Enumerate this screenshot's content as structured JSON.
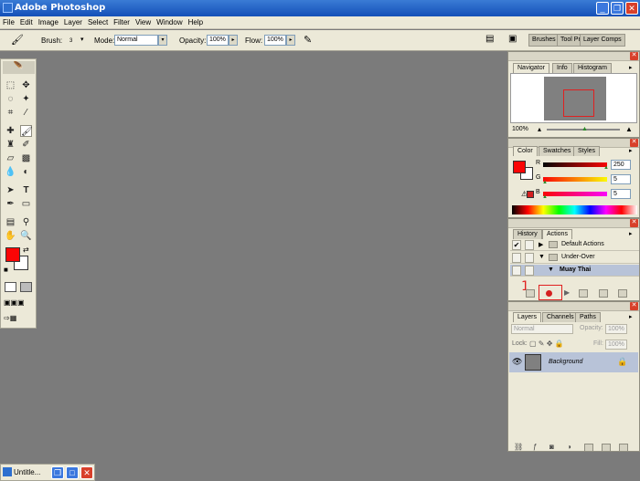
{
  "window": {
    "title": "Adobe Photoshop",
    "minimize": "_",
    "restore": "❐",
    "close": "✕"
  },
  "menu": [
    "File",
    "Edit",
    "Image",
    "Layer",
    "Select",
    "Filter",
    "View",
    "Window",
    "Help"
  ],
  "options": {
    "brush_label": "Brush:",
    "brush_size": "3",
    "mode_label": "Mode:",
    "mode_value": "Normal",
    "opacity_label": "Opacity:",
    "opacity_value": "100%",
    "flow_label": "Flow:",
    "flow_value": "100%",
    "well_tabs": [
      "Brushes",
      "Tool Pr",
      "Layer Comps"
    ]
  },
  "navigator": {
    "tabs": [
      "Navigator",
      "Info",
      "Histogram"
    ],
    "zoom": "100%"
  },
  "color": {
    "tabs": [
      "Color",
      "Swatches",
      "Styles"
    ],
    "channels": [
      {
        "label": "R",
        "value": "250"
      },
      {
        "label": "G",
        "value": "5"
      },
      {
        "label": "B",
        "value": "5"
      }
    ],
    "foreground": "#fa0505"
  },
  "actions": {
    "tabs": [
      "History",
      "Actions"
    ],
    "rows": [
      {
        "label": "Default Actions",
        "checked": true
      },
      {
        "label": "Under-Over",
        "checked": false
      },
      {
        "label": "Muay Thai",
        "checked": false
      }
    ],
    "annotation": "1"
  },
  "layers": {
    "tabs": [
      "Layers",
      "Channels",
      "Paths"
    ],
    "blend": "Normal",
    "opacity_label": "Opacity:",
    "opacity_value": "100%",
    "lock_label": "Lock:",
    "fill_label": "Fill:",
    "fill_value": "100%",
    "layer_name": "Background"
  },
  "taskbar": {
    "label": "Untitle..."
  },
  "colors": {
    "accent_red": "#e02020",
    "title_blue": "#1450b8"
  }
}
